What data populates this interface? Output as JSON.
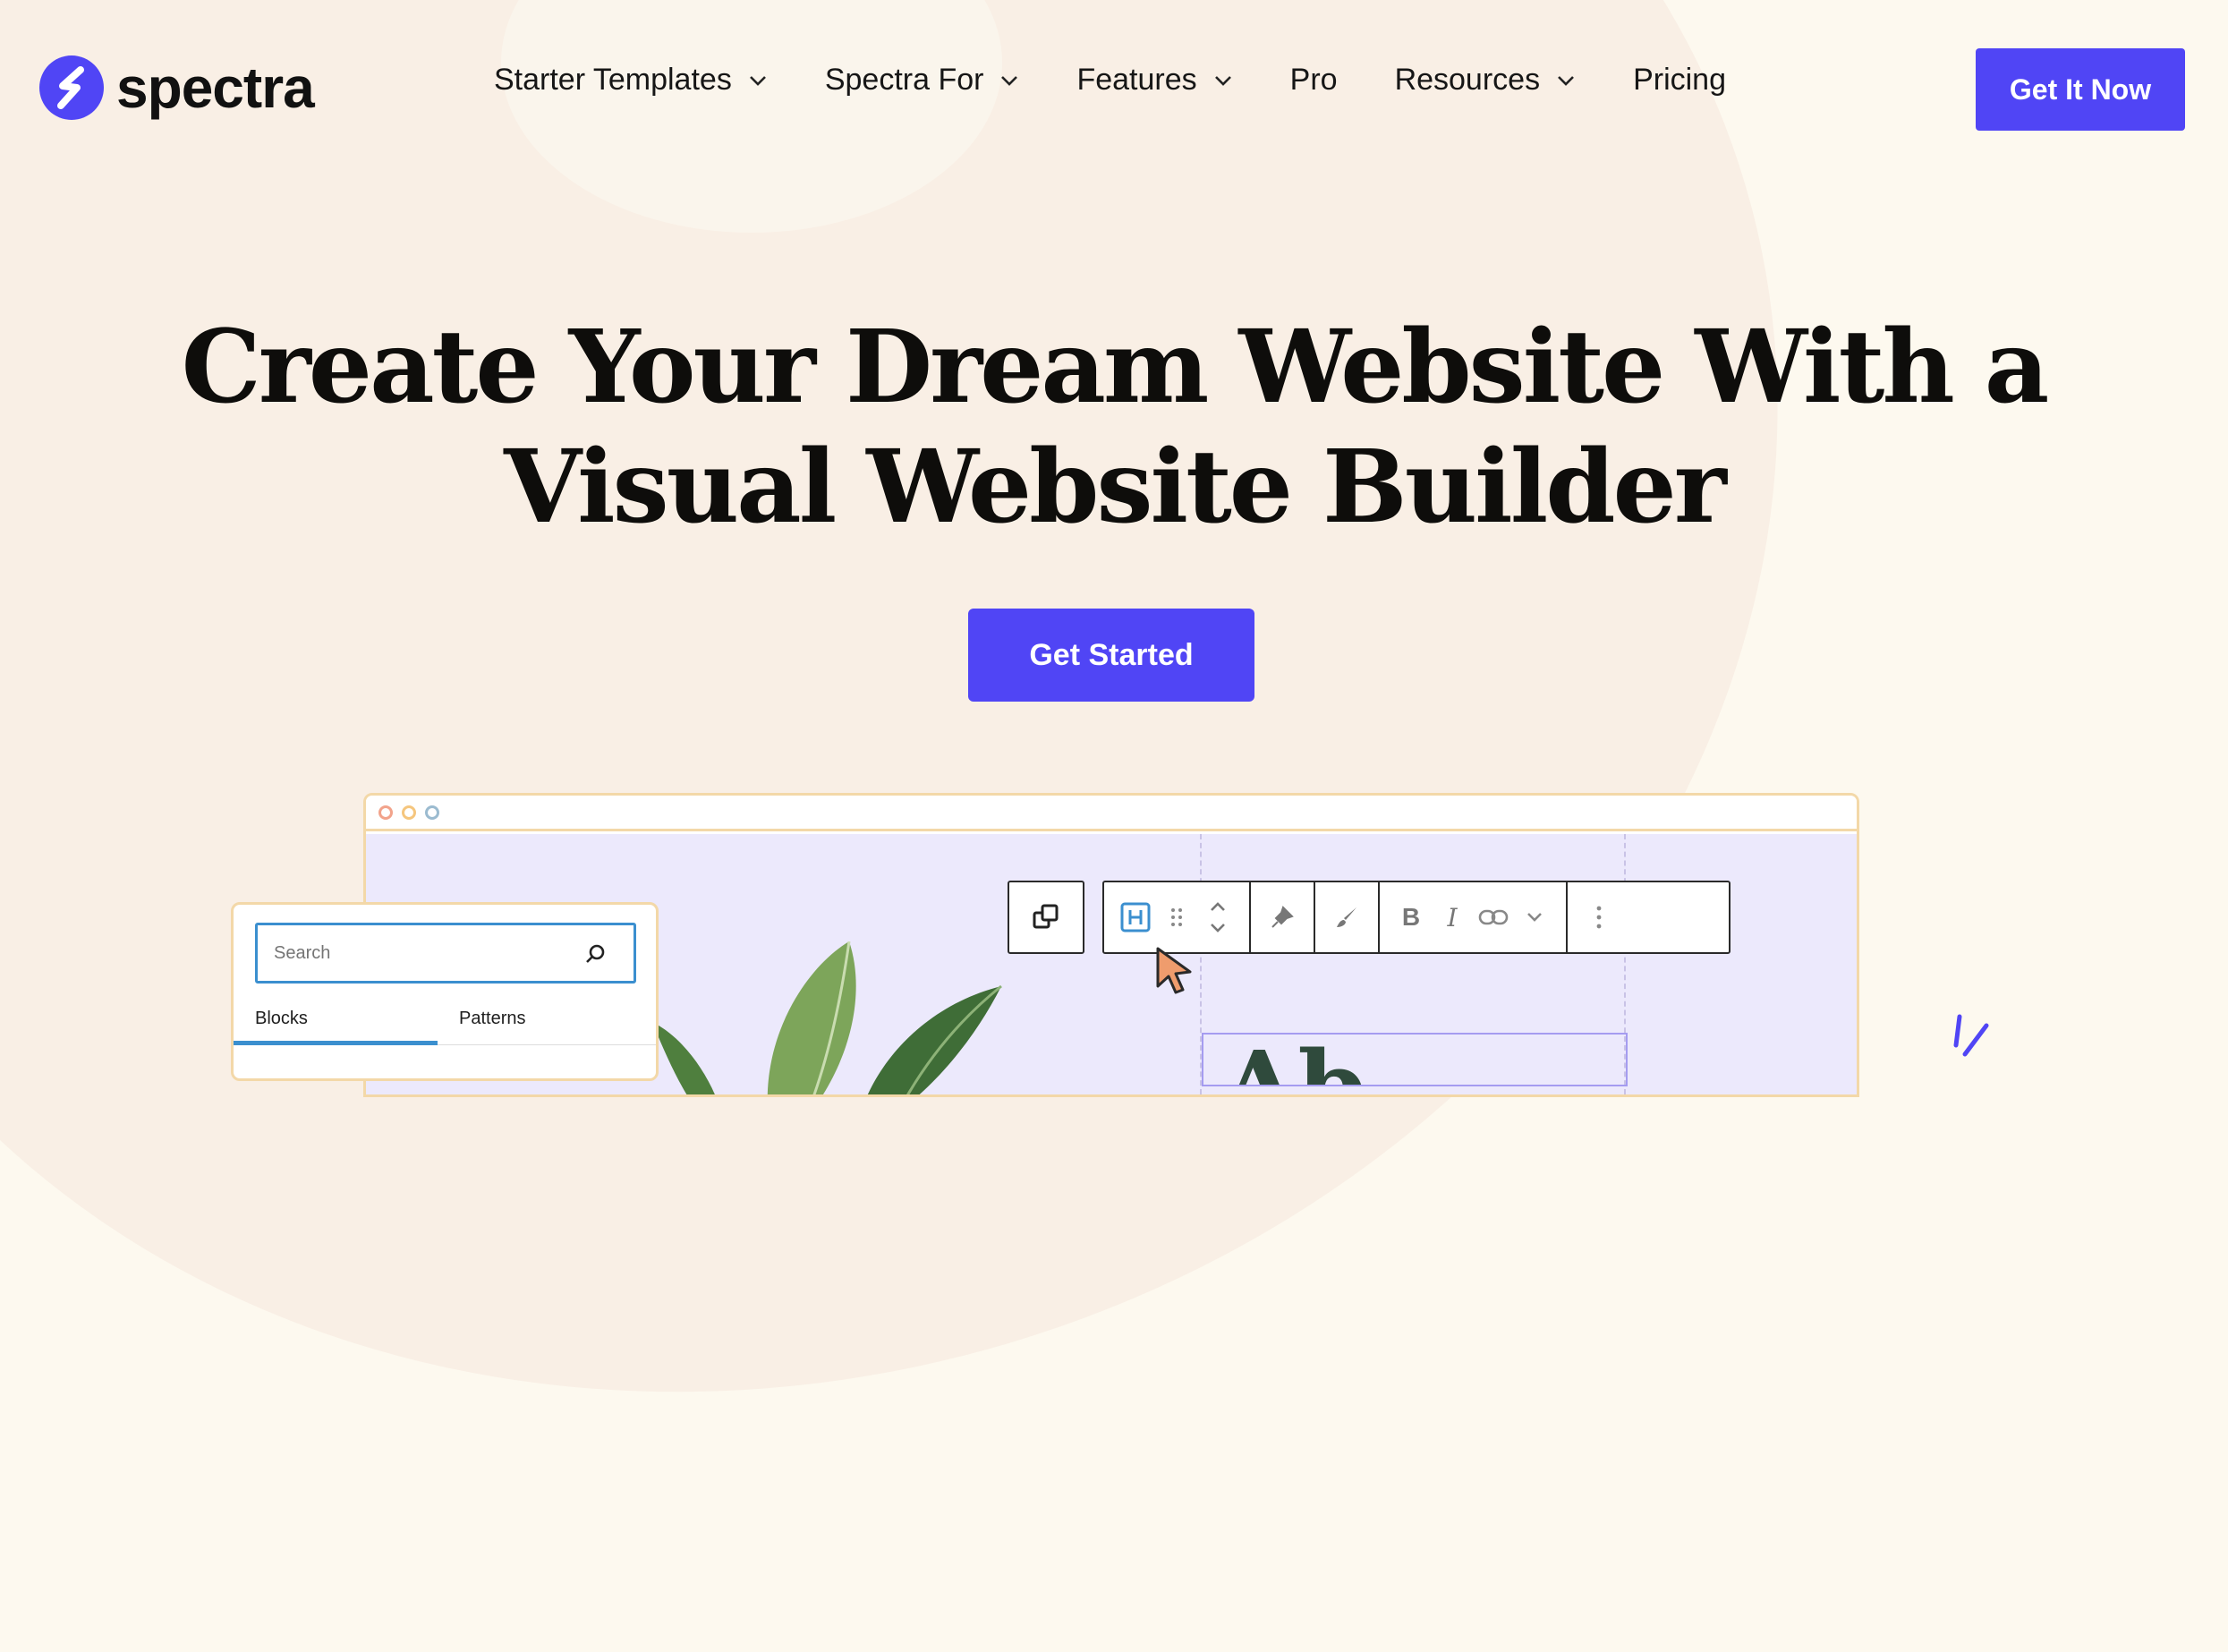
{
  "brand": {
    "name": "spectra",
    "color": "#5045f5",
    "logo_icon": "spectra-s-logo-icon"
  },
  "nav": {
    "items": [
      {
        "label": "Starter Templates",
        "has_dropdown": true
      },
      {
        "label": "Spectra For",
        "has_dropdown": true
      },
      {
        "label": "Features",
        "has_dropdown": true
      },
      {
        "label": "Pro",
        "has_dropdown": false
      },
      {
        "label": "Resources",
        "has_dropdown": true
      },
      {
        "label": "Pricing",
        "has_dropdown": false
      }
    ],
    "cta_label": "Get It Now"
  },
  "hero": {
    "title_line1": "Create Your Dream Website With a",
    "title_line2": "Visual Website Builder",
    "cta_label": "Get Started"
  },
  "editor_mockup": {
    "toolbar_icons": [
      "duplicate-icon",
      "heading-block-icon",
      "drag-handle-icon",
      "move-up-down-icon",
      "pin-icon",
      "brush-icon",
      "bold-icon",
      "italic-icon",
      "link-icon",
      "chevron-down-icon",
      "more-options-icon"
    ],
    "bold_label": "B",
    "italic_label": "I",
    "heading_preview": "Ab",
    "inserter": {
      "search_placeholder": "Search",
      "tabs": [
        "Blocks",
        "Patterns"
      ],
      "active_tab": "Blocks"
    }
  }
}
